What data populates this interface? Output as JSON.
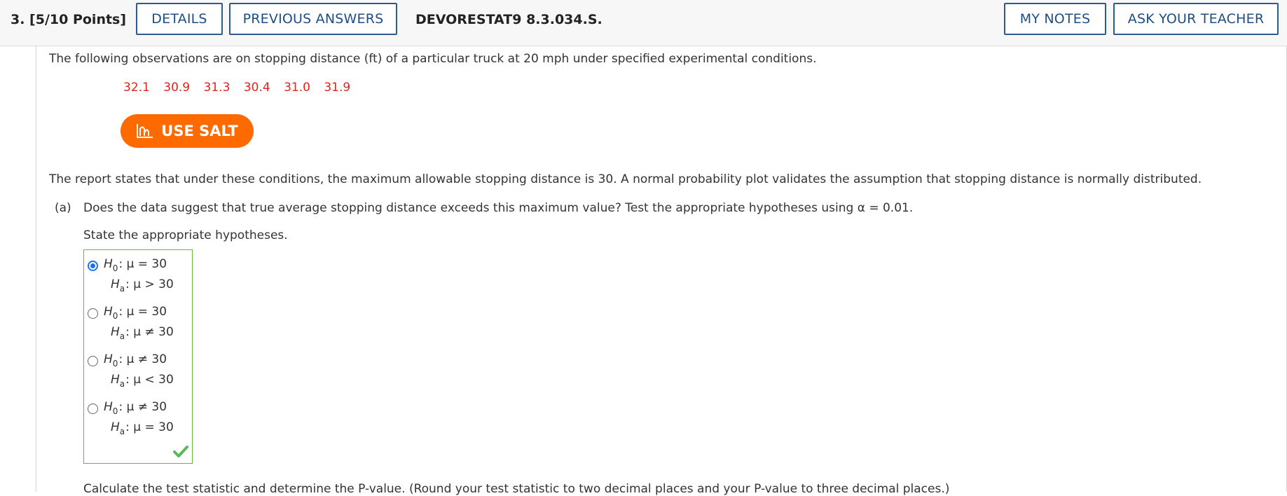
{
  "header": {
    "question_number": "3. [5/10 Points]",
    "details_label": "DETAILS",
    "previous_answers_label": "PREVIOUS ANSWERS",
    "code": "DEVORESTAT9 8.3.034.S.",
    "my_notes_label": "MY NOTES",
    "ask_teacher_label": "ASK YOUR TEACHER",
    "accent_color": "#2d5b8c"
  },
  "problem": {
    "intro": "The following observations are on stopping distance (ft) of a particular truck at 20 mph under specified experimental conditions.",
    "data": [
      "32.1",
      "30.9",
      "31.3",
      "30.4",
      "31.0",
      "31.9"
    ],
    "data_color": "#e0251b",
    "salt_label": "USE SALT",
    "salt_color": "#ff6a00",
    "report": "The report states that under these conditions, the maximum allowable stopping distance is 30. A normal probability plot validates the assumption that stopping distance is normally distributed."
  },
  "part_a": {
    "label": "(a)",
    "text": "Does the data suggest that true average stopping distance exceeds this maximum value? Test the appropriate hypotheses using α = 0.01.",
    "state_hypotheses": "State the appropriate hypotheses.",
    "hypothesis_symbols": {
      "h": "H",
      "null_sub": "0",
      "alt_sub": "a"
    },
    "options": [
      {
        "h0": ": μ = 30",
        "ha": ": μ > 30",
        "selected": true
      },
      {
        "h0": ": μ = 30",
        "ha": ": μ ≠ 30",
        "selected": false
      },
      {
        "h0": ": μ ≠ 30",
        "ha": ": μ < 30",
        "selected": false
      },
      {
        "h0": ": μ ≠ 30",
        "ha": ": μ = 30",
        "selected": false
      }
    ],
    "correct_icon": "checkmark-icon",
    "calculate_text": "Calculate the test statistic and determine the P-value. (Round your test statistic to two decimal places and your P-value to three decimal places.)"
  }
}
